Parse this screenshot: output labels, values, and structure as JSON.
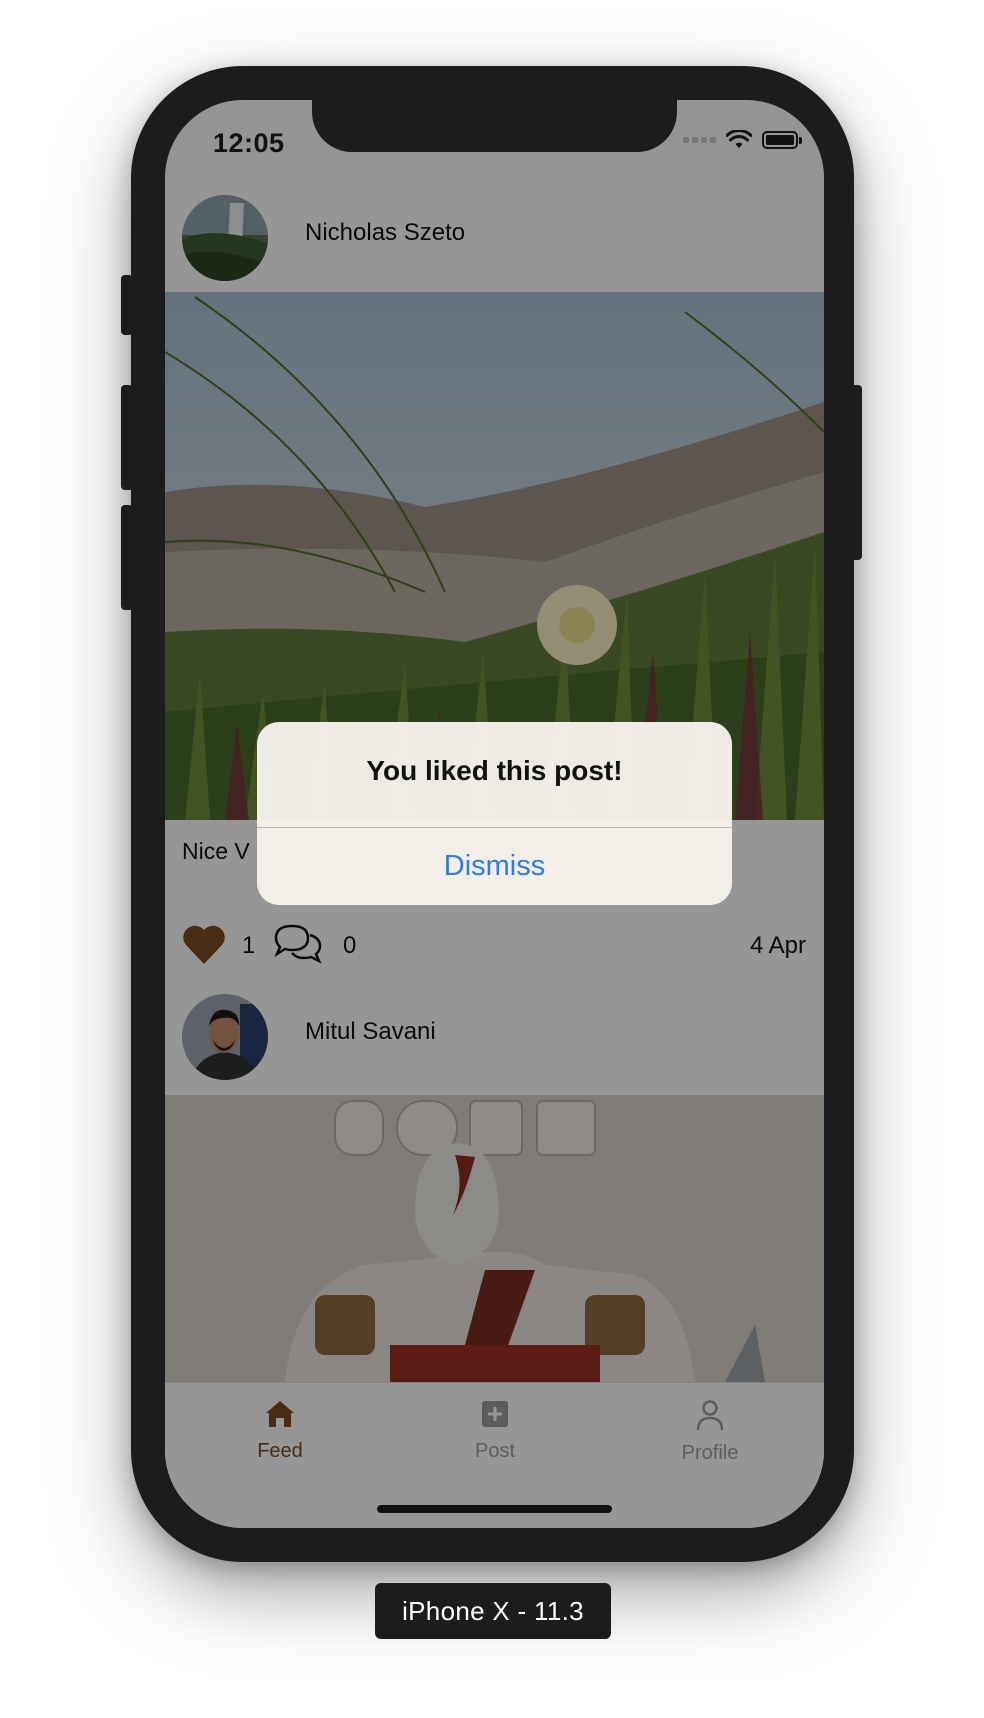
{
  "status_bar": {
    "time": "12:05"
  },
  "feed": {
    "posts": [
      {
        "author": "Nicholas Szeto",
        "caption": "Nice V",
        "likes": "1",
        "comments": "0",
        "date": "4 Apr"
      },
      {
        "author": "Mitul Savani"
      }
    ]
  },
  "alert": {
    "title": "You liked this post!",
    "button": "Dismiss"
  },
  "tabbar": {
    "items": [
      {
        "label": "Feed",
        "icon": "home-icon"
      },
      {
        "label": "Post",
        "icon": "plus-square-icon"
      },
      {
        "label": "Profile",
        "icon": "person-icon"
      }
    ]
  },
  "colors": {
    "accent": "#7a4a22",
    "link": "#2f7be6",
    "inactive": "#9a9a9a"
  },
  "device_label": "iPhone X - 11.3"
}
